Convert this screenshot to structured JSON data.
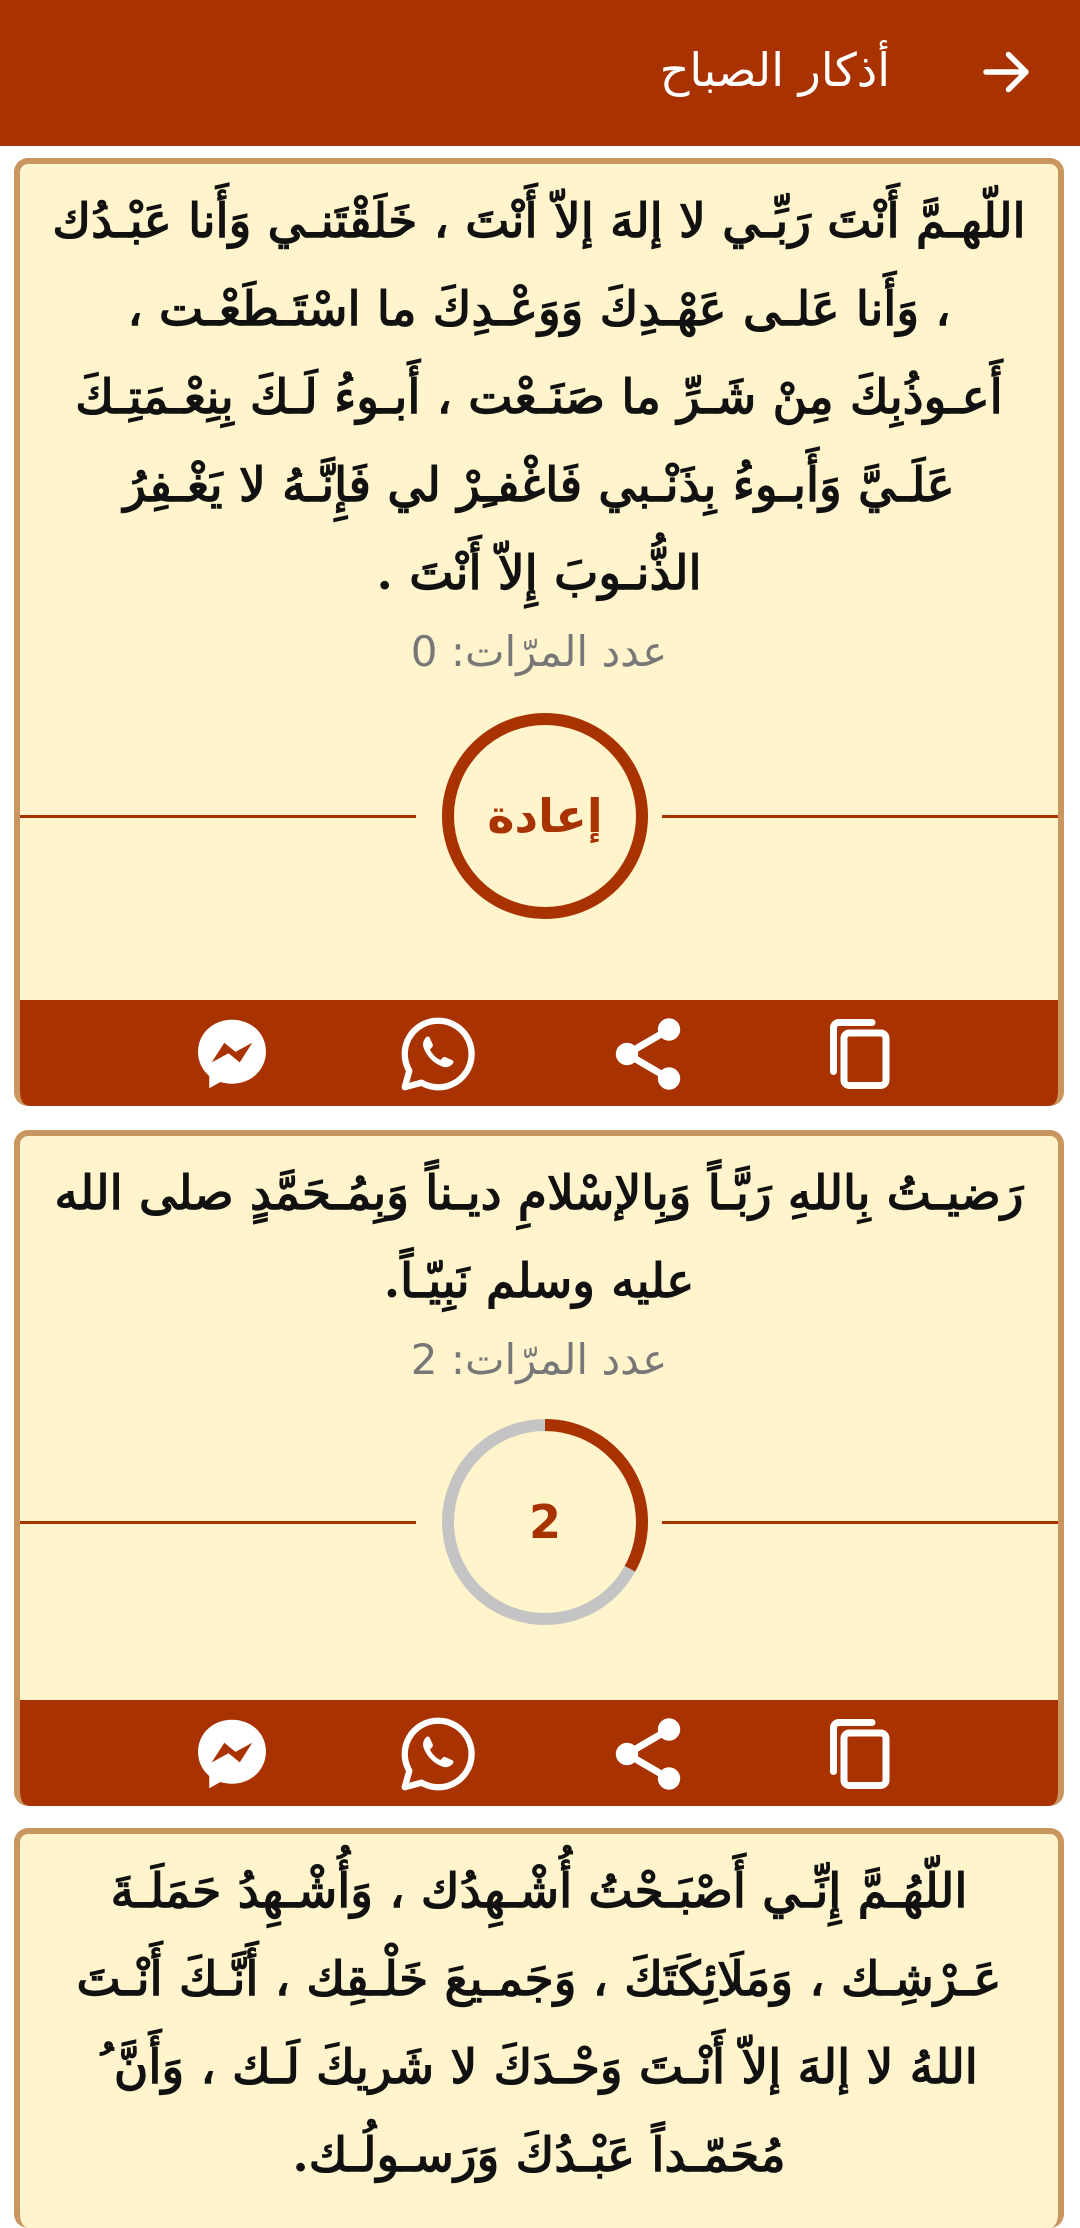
{
  "header": {
    "title": "أذكار الصباح",
    "back_icon": "arrow-right-icon"
  },
  "cards": [
    {
      "text": "اللّهـمَّ أَنْتَ رَبِّـي لا إلهَ إلاّ أَنْتَ ، خَلَقْتَنـي وَأَنا عَبْـدُك ، وَأَنا عَلـى عَهْـدِكَ وَوَعْـدِكَ ما اسْتَـطَعْـت ، أَعـوذُبِكَ مِنْ شَـرِّ ما صَنَـعْت ، أَبـوءُ لَـكَ بِنِعْـمَتِـكَ عَلَـيَّ وَأَبـوءُ بِذَنْـبي فَاغْفـِرْ لي فَإِنَّـهُ لا يَغْـفِرُ الذُّنـوبَ إِلاّ أَنْتَ .",
      "count_label": "عدد المرّات: 0",
      "ring_label": "إعادة",
      "progress": 0
    },
    {
      "text": "رَضيـتُ بِاللهِ رَبَّـاً وَبِالإسْلامِ ديـناً وَبِمُـحَمَّدٍ صلى الله عليه وسلم نَبِيّـاً.",
      "count_label": "عدد المرّات: 2",
      "ring_label": "2",
      "progress": 0.33
    },
    {
      "text": "اللّهُـمَّ إِنِّـي أَصْبَـحْتُ أُشْـهِدُك ، وَأُشْـهِدُ حَمَلَـةَ عَـرْشِـك ، وَمَلَائِكَتَكَ ، وَجَمـيعَ خَلْـقِك ، أَنَّـكَ أَنْـتَ اللهُ لا إلهَ إلاّ أَنْـتَ وَحْـدَكَ لا شَريكَ لَـك ، وَأَنَّ ُ مُحَمّـداً عَبْـدُكَ وَرَسـولُـك."
    }
  ],
  "toolbar": {
    "icons": [
      "messenger-icon",
      "whatsapp-icon",
      "share-icon",
      "copy-icon"
    ]
  },
  "colors": {
    "primary": "#a83200",
    "card_background": "#fff4cc",
    "card_border": "#c9965f",
    "progress_track": "#c4c4c4"
  }
}
